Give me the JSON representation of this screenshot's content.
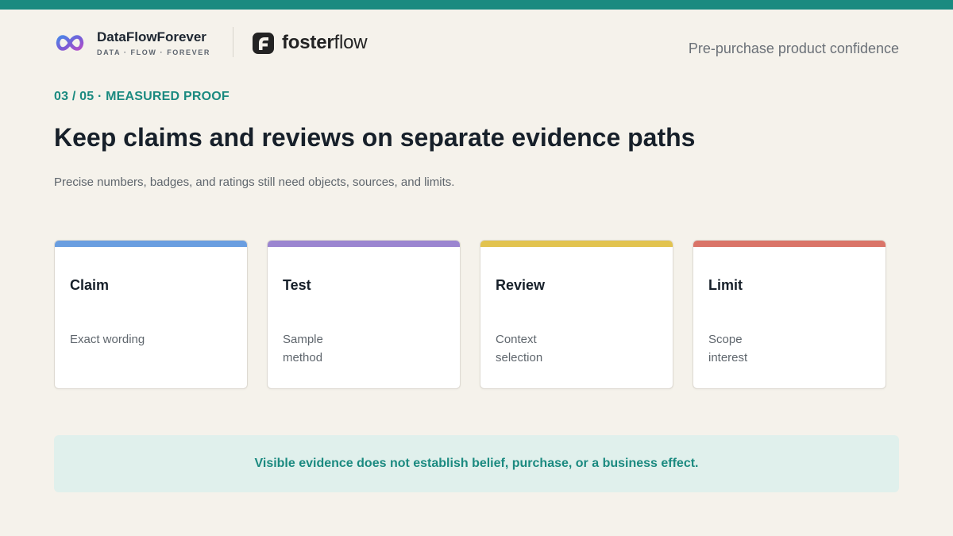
{
  "colors": {
    "accent": "#1b8a80",
    "background": "#f5f2eb",
    "callout_bg": "#e0f0ec"
  },
  "header": {
    "brand_name": "DataFlowForever",
    "brand_tagline": "DATA · FLOW · FOREVER",
    "brand_icon": "infinity-logo-icon",
    "partner_name_bold": "foster",
    "partner_name_light": "flow",
    "partner_icon": "fosterflow-logo-icon",
    "right_text": "Pre-purchase product confidence"
  },
  "eyebrow": "03 / 05 · MEASURED PROOF",
  "title": "Keep claims and reviews on separate evidence paths",
  "subtitle": "Precise numbers, badges, and ratings still need objects, sources, and limits.",
  "cards": [
    {
      "title": "Claim",
      "lines": [
        "Exact wording"
      ],
      "color": "#6a9ee0"
    },
    {
      "title": "Test",
      "lines": [
        "Sample",
        "method"
      ],
      "color": "#9b85d0"
    },
    {
      "title": "Review",
      "lines": [
        "Context",
        "selection"
      ],
      "color": "#e2c34f"
    },
    {
      "title": "Limit",
      "lines": [
        "Scope",
        "interest"
      ],
      "color": "#da7468"
    }
  ],
  "callout": "Visible evidence does not establish belief, purchase, or a business effect."
}
